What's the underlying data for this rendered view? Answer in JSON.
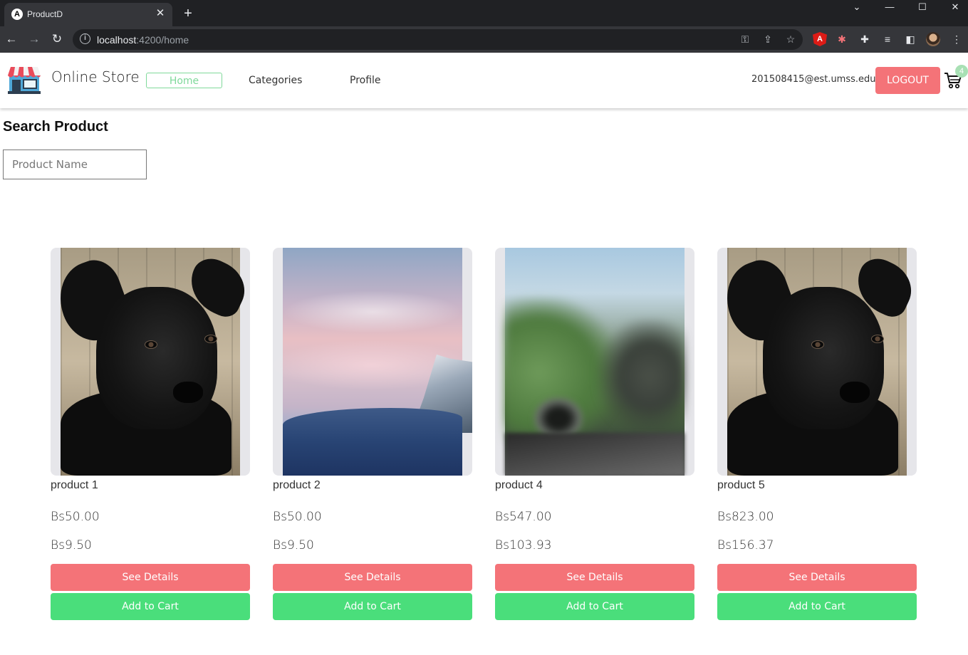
{
  "browser": {
    "tab_title": "ProductD",
    "tab_favicon": "A",
    "url_host": "localhost",
    "url_path": ":4200/home"
  },
  "header": {
    "brand": "Online Store",
    "nav": {
      "home": "Home",
      "categories": "Categories",
      "profile": "Profile"
    },
    "user_email": "201508415@est.umss.edu",
    "logout_label": "LOGOUT",
    "cart_count": "4"
  },
  "search": {
    "title": "Search Product",
    "placeholder": "Product Name"
  },
  "products": [
    {
      "name": "product 1",
      "price": "Bs50.00",
      "discounted": "Bs9.50",
      "image": "black-puppy-photo"
    },
    {
      "name": "product 2",
      "price": "Bs50.00",
      "discounted": "Bs9.50",
      "image": "pink-sky-mountain-photo"
    },
    {
      "name": "product 4",
      "price": "Bs547.00",
      "discounted": "Bs103.93",
      "image": "blurred-valley-photo"
    },
    {
      "name": "product 5",
      "price": "Bs823.00",
      "discounted": "Bs156.37",
      "image": "black-puppy-photo"
    }
  ],
  "buttons": {
    "details": "See Details",
    "cart": "Add to Cart"
  },
  "colors": {
    "logout": "#f47378",
    "details_button": "#f47378",
    "cart_button": "#4ade7b",
    "nav_active": "#7fd99a"
  }
}
